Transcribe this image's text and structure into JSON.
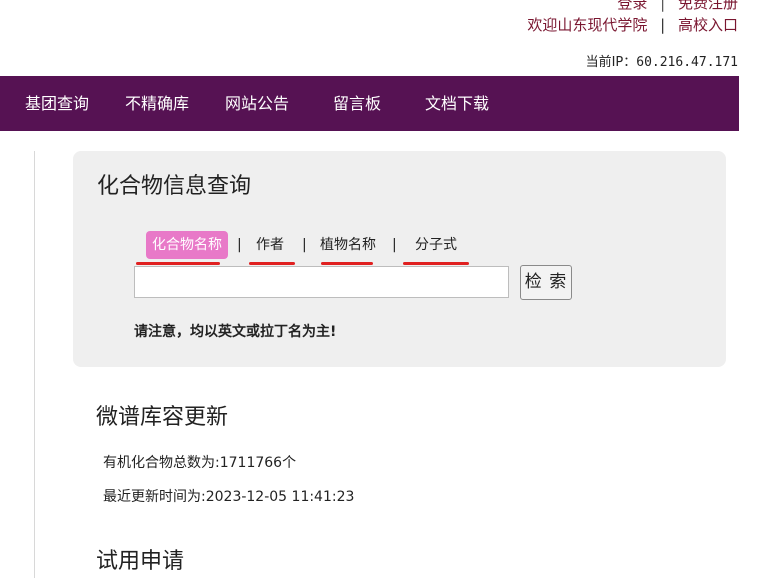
{
  "header": {
    "login_label": "登录",
    "register_label": "免费注册",
    "link_separator": "|",
    "welcome_text": "欢迎山东现代学院",
    "school_entry_label": "高校入口",
    "ip_label": "当前IP：",
    "ip_value": "60.216.47.171"
  },
  "nav": {
    "items": [
      {
        "label": "基团查询"
      },
      {
        "label": "不精确库"
      },
      {
        "label": "网站公告"
      },
      {
        "label": "留言板"
      },
      {
        "label": "文档下载"
      }
    ]
  },
  "search_panel": {
    "title": "化合物信息查询",
    "tabs": [
      {
        "label": "化合物名称",
        "active": true
      },
      {
        "label": "作者",
        "active": false
      },
      {
        "label": "植物名称",
        "active": false
      },
      {
        "label": "分子式",
        "active": false
      }
    ],
    "tab_separator": "|",
    "input_value": "",
    "search_button_label": "检 索",
    "notice": "请注意，均以英文或拉丁名为主!"
  },
  "update_section": {
    "title": "微谱库容更新",
    "total_label": "有机化合物总数为:",
    "total_value": "1711766",
    "total_unit": "个",
    "updated_label": "最近更新时间为:",
    "updated_value": "2023-12-05 11:41:23"
  },
  "trial_section": {
    "title": "试用申请"
  },
  "colors": {
    "nav_background": "#561253",
    "active_tab": "#e879c8",
    "link_color": "#7a1630",
    "annotation_underline": "#e02020",
    "panel_background": "#efefef"
  }
}
